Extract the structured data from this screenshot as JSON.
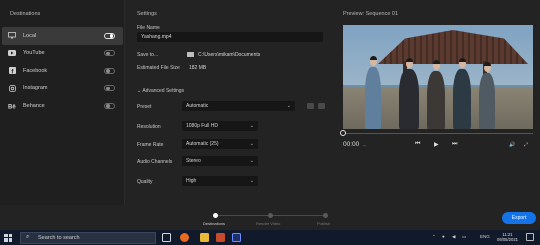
{
  "destinations": {
    "title": "Destinations",
    "items": [
      {
        "label": "Local",
        "icon": "monitor-icon",
        "enabled": true,
        "selected": true
      },
      {
        "label": "YouTube",
        "icon": "youtube-icon",
        "enabled": false,
        "selected": false
      },
      {
        "label": "Facebook",
        "icon": "facebook-icon",
        "enabled": false,
        "selected": false
      },
      {
        "label": "Instagram",
        "icon": "instagram-icon",
        "enabled": false,
        "selected": false
      },
      {
        "label": "Behance",
        "icon": "behance-icon",
        "enabled": false,
        "selected": false
      }
    ]
  },
  "settings": {
    "title": "Settings",
    "file_name_label": "File Name",
    "file_name_value": "Yashang.mp4",
    "save_to_label": "Save to...",
    "save_to_value": "C:\\Users\\mikam\\Documents",
    "size_label": "Estimated File Size",
    "size_value": "182 MB",
    "advanced_label": "Advanced Settings",
    "preset_label": "Preset",
    "preset_value": "Automatic",
    "resolution_label": "Resolution",
    "resolution_value": "1080p Full HD",
    "framerate_label": "Frame Rate",
    "framerate_value": "Automatic (25)",
    "audio_label": "Audio Channels",
    "audio_value": "Stereo",
    "quality_label": "Quality",
    "quality_value": "High"
  },
  "preview": {
    "title": "Preview: Sequence 01",
    "timecode": "00:00",
    "playhead_fraction": 0.0
  },
  "steps": {
    "items": [
      "Destinations",
      "Render Video",
      "Publish"
    ],
    "active_index": 0
  },
  "export_label": "Export",
  "taskbar": {
    "search_placeholder": "Search to search",
    "language": "ENG",
    "time": "11:21",
    "date": "09/05/2021",
    "tray_icons": [
      "chevron-up-icon",
      "microphone-icon",
      "speaker-icon",
      "network-icon"
    ]
  },
  "colors": {
    "accent": "#1473e6",
    "panel": "#232323",
    "taskbar": "#101a2a"
  }
}
